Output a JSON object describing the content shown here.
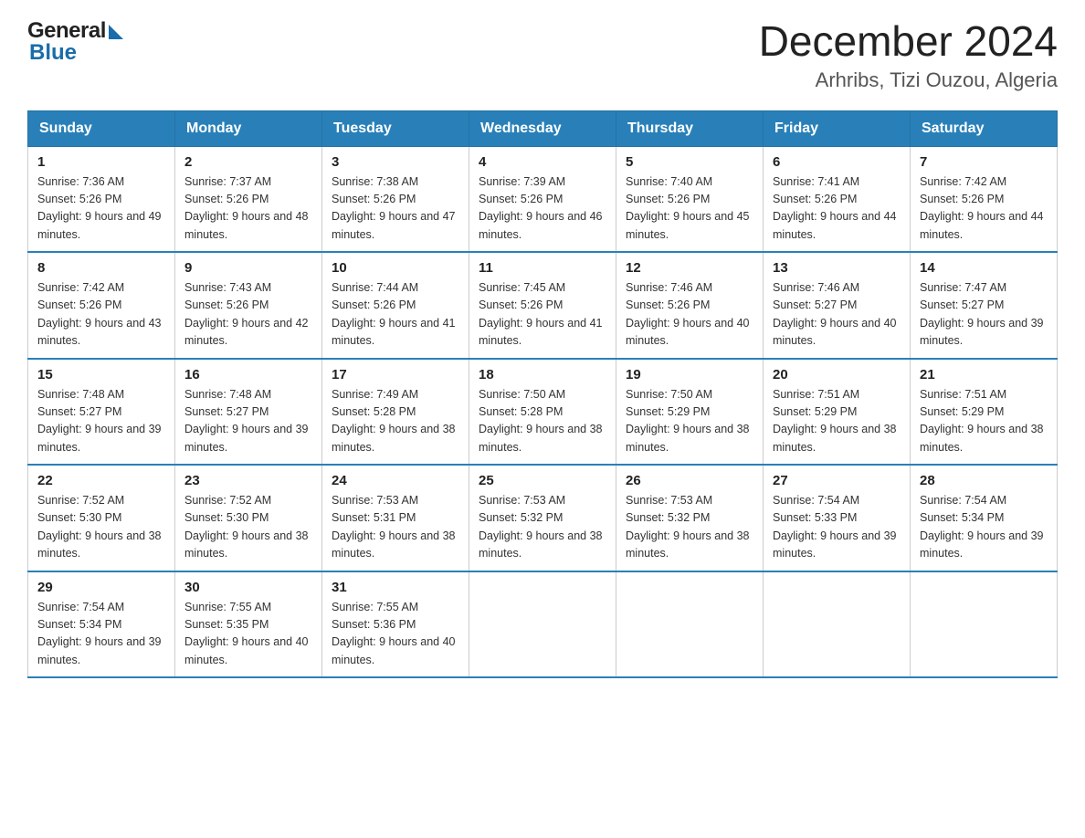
{
  "header": {
    "title": "December 2024",
    "subtitle": "Arhribs, Tizi Ouzou, Algeria",
    "logo_general": "General",
    "logo_blue": "Blue"
  },
  "days_of_week": [
    "Sunday",
    "Monday",
    "Tuesday",
    "Wednesday",
    "Thursday",
    "Friday",
    "Saturday"
  ],
  "weeks": [
    [
      {
        "day": "1",
        "sunrise": "7:36 AM",
        "sunset": "5:26 PM",
        "daylight": "9 hours and 49 minutes."
      },
      {
        "day": "2",
        "sunrise": "7:37 AM",
        "sunset": "5:26 PM",
        "daylight": "9 hours and 48 minutes."
      },
      {
        "day": "3",
        "sunrise": "7:38 AM",
        "sunset": "5:26 PM",
        "daylight": "9 hours and 47 minutes."
      },
      {
        "day": "4",
        "sunrise": "7:39 AM",
        "sunset": "5:26 PM",
        "daylight": "9 hours and 46 minutes."
      },
      {
        "day": "5",
        "sunrise": "7:40 AM",
        "sunset": "5:26 PM",
        "daylight": "9 hours and 45 minutes."
      },
      {
        "day": "6",
        "sunrise": "7:41 AM",
        "sunset": "5:26 PM",
        "daylight": "9 hours and 44 minutes."
      },
      {
        "day": "7",
        "sunrise": "7:42 AM",
        "sunset": "5:26 PM",
        "daylight": "9 hours and 44 minutes."
      }
    ],
    [
      {
        "day": "8",
        "sunrise": "7:42 AM",
        "sunset": "5:26 PM",
        "daylight": "9 hours and 43 minutes."
      },
      {
        "day": "9",
        "sunrise": "7:43 AM",
        "sunset": "5:26 PM",
        "daylight": "9 hours and 42 minutes."
      },
      {
        "day": "10",
        "sunrise": "7:44 AM",
        "sunset": "5:26 PM",
        "daylight": "9 hours and 41 minutes."
      },
      {
        "day": "11",
        "sunrise": "7:45 AM",
        "sunset": "5:26 PM",
        "daylight": "9 hours and 41 minutes."
      },
      {
        "day": "12",
        "sunrise": "7:46 AM",
        "sunset": "5:26 PM",
        "daylight": "9 hours and 40 minutes."
      },
      {
        "day": "13",
        "sunrise": "7:46 AM",
        "sunset": "5:27 PM",
        "daylight": "9 hours and 40 minutes."
      },
      {
        "day": "14",
        "sunrise": "7:47 AM",
        "sunset": "5:27 PM",
        "daylight": "9 hours and 39 minutes."
      }
    ],
    [
      {
        "day": "15",
        "sunrise": "7:48 AM",
        "sunset": "5:27 PM",
        "daylight": "9 hours and 39 minutes."
      },
      {
        "day": "16",
        "sunrise": "7:48 AM",
        "sunset": "5:27 PM",
        "daylight": "9 hours and 39 minutes."
      },
      {
        "day": "17",
        "sunrise": "7:49 AM",
        "sunset": "5:28 PM",
        "daylight": "9 hours and 38 minutes."
      },
      {
        "day": "18",
        "sunrise": "7:50 AM",
        "sunset": "5:28 PM",
        "daylight": "9 hours and 38 minutes."
      },
      {
        "day": "19",
        "sunrise": "7:50 AM",
        "sunset": "5:29 PM",
        "daylight": "9 hours and 38 minutes."
      },
      {
        "day": "20",
        "sunrise": "7:51 AM",
        "sunset": "5:29 PM",
        "daylight": "9 hours and 38 minutes."
      },
      {
        "day": "21",
        "sunrise": "7:51 AM",
        "sunset": "5:29 PM",
        "daylight": "9 hours and 38 minutes."
      }
    ],
    [
      {
        "day": "22",
        "sunrise": "7:52 AM",
        "sunset": "5:30 PM",
        "daylight": "9 hours and 38 minutes."
      },
      {
        "day": "23",
        "sunrise": "7:52 AM",
        "sunset": "5:30 PM",
        "daylight": "9 hours and 38 minutes."
      },
      {
        "day": "24",
        "sunrise": "7:53 AM",
        "sunset": "5:31 PM",
        "daylight": "9 hours and 38 minutes."
      },
      {
        "day": "25",
        "sunrise": "7:53 AM",
        "sunset": "5:32 PM",
        "daylight": "9 hours and 38 minutes."
      },
      {
        "day": "26",
        "sunrise": "7:53 AM",
        "sunset": "5:32 PM",
        "daylight": "9 hours and 38 minutes."
      },
      {
        "day": "27",
        "sunrise": "7:54 AM",
        "sunset": "5:33 PM",
        "daylight": "9 hours and 39 minutes."
      },
      {
        "day": "28",
        "sunrise": "7:54 AM",
        "sunset": "5:34 PM",
        "daylight": "9 hours and 39 minutes."
      }
    ],
    [
      {
        "day": "29",
        "sunrise": "7:54 AM",
        "sunset": "5:34 PM",
        "daylight": "9 hours and 39 minutes."
      },
      {
        "day": "30",
        "sunrise": "7:55 AM",
        "sunset": "5:35 PM",
        "daylight": "9 hours and 40 minutes."
      },
      {
        "day": "31",
        "sunrise": "7:55 AM",
        "sunset": "5:36 PM",
        "daylight": "9 hours and 40 minutes."
      },
      null,
      null,
      null,
      null
    ]
  ]
}
